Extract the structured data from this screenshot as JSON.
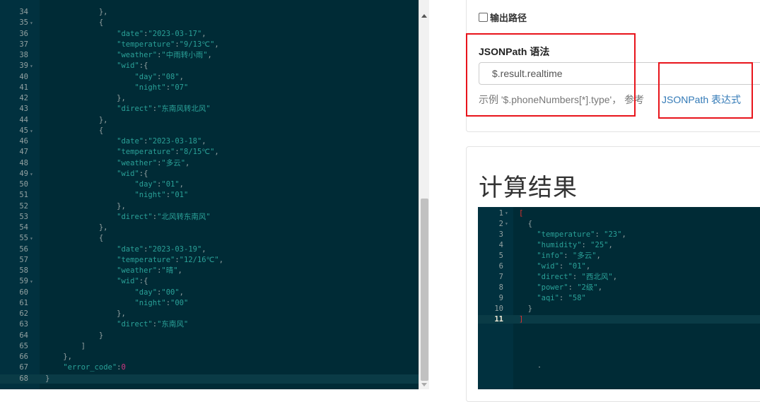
{
  "left_editor": {
    "lines": [
      {
        "n": "34",
        "fold": false,
        "code": "            },"
      },
      {
        "n": "35",
        "fold": true,
        "code": "            {"
      },
      {
        "n": "36",
        "fold": false,
        "code": "                \"date\":\"2023-03-17\","
      },
      {
        "n": "37",
        "fold": false,
        "code": "                \"temperature\":\"9/13℃\","
      },
      {
        "n": "38",
        "fold": false,
        "code": "                \"weather\":\"中雨转小雨\","
      },
      {
        "n": "39",
        "fold": true,
        "code": "                \"wid\":{"
      },
      {
        "n": "40",
        "fold": false,
        "code": "                    \"day\":\"08\","
      },
      {
        "n": "41",
        "fold": false,
        "code": "                    \"night\":\"07\""
      },
      {
        "n": "42",
        "fold": false,
        "code": "                },"
      },
      {
        "n": "43",
        "fold": false,
        "code": "                \"direct\":\"东南风转北风\""
      },
      {
        "n": "44",
        "fold": false,
        "code": "            },"
      },
      {
        "n": "45",
        "fold": true,
        "code": "            {"
      },
      {
        "n": "46",
        "fold": false,
        "code": "                \"date\":\"2023-03-18\","
      },
      {
        "n": "47",
        "fold": false,
        "code": "                \"temperature\":\"8/15℃\","
      },
      {
        "n": "48",
        "fold": false,
        "code": "                \"weather\":\"多云\","
      },
      {
        "n": "49",
        "fold": true,
        "code": "                \"wid\":{"
      },
      {
        "n": "50",
        "fold": false,
        "code": "                    \"day\":\"01\","
      },
      {
        "n": "51",
        "fold": false,
        "code": "                    \"night\":\"01\""
      },
      {
        "n": "52",
        "fold": false,
        "code": "                },"
      },
      {
        "n": "53",
        "fold": false,
        "code": "                \"direct\":\"北风转东南风\""
      },
      {
        "n": "54",
        "fold": false,
        "code": "            },"
      },
      {
        "n": "55",
        "fold": true,
        "code": "            {"
      },
      {
        "n": "56",
        "fold": false,
        "code": "                \"date\":\"2023-03-19\","
      },
      {
        "n": "57",
        "fold": false,
        "code": "                \"temperature\":\"12/16℃\","
      },
      {
        "n": "58",
        "fold": false,
        "code": "                \"weather\":\"晴\","
      },
      {
        "n": "59",
        "fold": true,
        "code": "                \"wid\":{"
      },
      {
        "n": "60",
        "fold": false,
        "code": "                    \"day\":\"00\","
      },
      {
        "n": "61",
        "fold": false,
        "code": "                    \"night\":\"00\""
      },
      {
        "n": "62",
        "fold": false,
        "code": "                },"
      },
      {
        "n": "63",
        "fold": false,
        "code": "                \"direct\":\"东南风\""
      },
      {
        "n": "64",
        "fold": false,
        "code": "            }"
      },
      {
        "n": "65",
        "fold": false,
        "code": "        ]"
      },
      {
        "n": "66",
        "fold": false,
        "code": "    },"
      },
      {
        "n": "67",
        "fold": false,
        "code": "    \"error_code\":0"
      },
      {
        "n": "68",
        "fold": false,
        "code": "}"
      }
    ]
  },
  "options": {
    "output_path_label": "输出路径",
    "output_path_checked": false
  },
  "jsonpath": {
    "section_label": "JSONPath 语法",
    "input_value": "$.result.realtime",
    "help_text": "示例 '$.phoneNumbers[*].type'，  参考",
    "help_link": "JSONPath 表达式"
  },
  "result": {
    "title": "计算结果",
    "lines": [
      {
        "n": "1",
        "fold": true,
        "code": "["
      },
      {
        "n": "2",
        "fold": true,
        "code": "  {"
      },
      {
        "n": "3",
        "fold": false,
        "code": "    \"temperature\": \"23\","
      },
      {
        "n": "4",
        "fold": false,
        "code": "    \"humidity\": \"25\","
      },
      {
        "n": "5",
        "fold": false,
        "code": "    \"info\": \"多云\","
      },
      {
        "n": "6",
        "fold": false,
        "code": "    \"wid\": \"01\","
      },
      {
        "n": "7",
        "fold": false,
        "code": "    \"direct\": \"西北风\","
      },
      {
        "n": "8",
        "fold": false,
        "code": "    \"power\": \"2级\","
      },
      {
        "n": "9",
        "fold": false,
        "code": "    \"aqi\": \"58\""
      },
      {
        "n": "10",
        "fold": false,
        "code": "  }"
      },
      {
        "n": "11",
        "fold": false,
        "code": "]"
      }
    ],
    "active_line": "11"
  },
  "colors": {
    "editor_bg": "#002b36",
    "string": "#2aa198",
    "number": "#d33682",
    "highlight_border": "#e8141b",
    "link": "#337ab7"
  }
}
